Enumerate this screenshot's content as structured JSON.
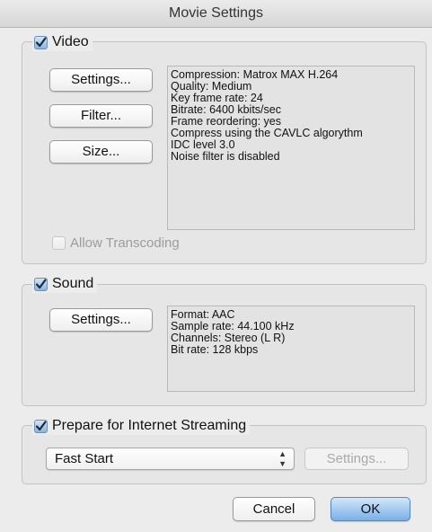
{
  "window": {
    "title": "Movie Settings"
  },
  "video": {
    "label": "Video",
    "checked": true,
    "buttons": {
      "settings": "Settings...",
      "filter": "Filter...",
      "size": "Size..."
    },
    "info_lines": [
      "Compression: Matrox MAX H.264",
      "Quality: Medium",
      "Key frame rate: 24",
      "Bitrate: 6400 kbits/sec",
      "Frame reordering: yes",
      "Compress using the CAVLC algorythm",
      "IDC level 3.0",
      "Noise filter is disabled"
    ],
    "allow_transcoding": {
      "label": "Allow Transcoding",
      "checked": false,
      "enabled": false
    }
  },
  "sound": {
    "label": "Sound",
    "checked": true,
    "buttons": {
      "settings": "Settings..."
    },
    "info_lines": [
      "Format: AAC",
      "Sample rate: 44.100 kHz",
      "Channels: Stereo (L R)",
      "Bit rate: 128 kbps"
    ]
  },
  "streaming": {
    "label": "Prepare for Internet Streaming",
    "checked": true,
    "selected_option": "Fast Start",
    "settings_label": "Settings...",
    "settings_enabled": false
  },
  "footer": {
    "cancel_label": "Cancel",
    "ok_label": "OK"
  },
  "colors": {
    "accent": "#7ab0e6",
    "window_bg": "#ececec"
  }
}
